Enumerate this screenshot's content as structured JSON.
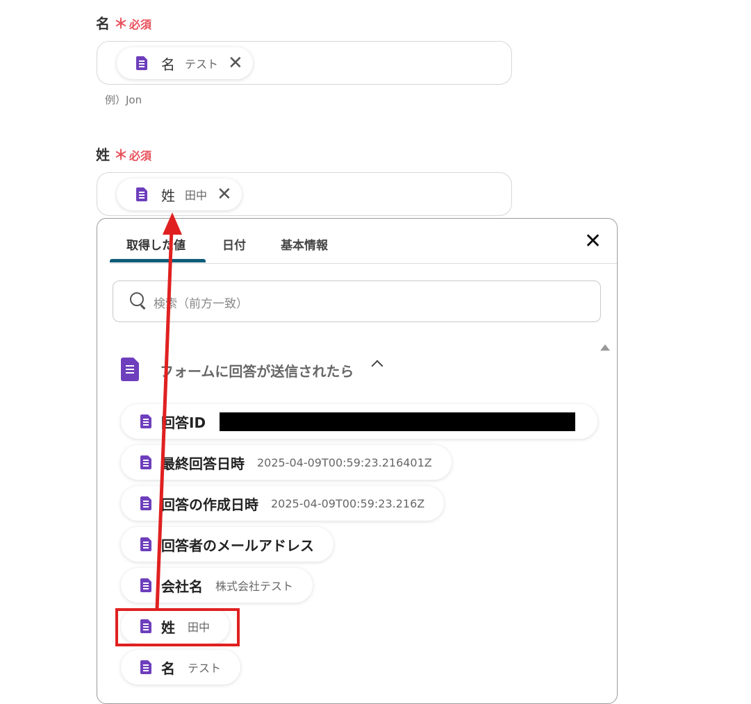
{
  "fields": [
    {
      "label": "名",
      "required_mark": "＊",
      "required_text": "必須",
      "chip_name": "名",
      "chip_value": "テスト",
      "chip_remove": "✕",
      "hint": "例）Jon"
    },
    {
      "label": "姓",
      "required_mark": "＊",
      "required_text": "必須",
      "chip_name": "姓",
      "chip_value": "田中",
      "chip_remove": "✕"
    }
  ],
  "panel": {
    "tabs": [
      "取得した値",
      "日付",
      "基本情報"
    ],
    "active_tab": 0,
    "close_label": "✕",
    "search_placeholder": "検索（前方一致）",
    "group": {
      "title": "フォームに回答が送信されたら",
      "expanded": true,
      "items": [
        {
          "name": "回答ID",
          "value": "",
          "redacted": true
        },
        {
          "name": "最終回答日時",
          "value": "2025-04-09T00:59:23.216401Z"
        },
        {
          "name": "回答の作成日時",
          "value": "2025-04-09T00:59:23.216Z"
        },
        {
          "name": "回答者のメールアドレス",
          "value": ""
        },
        {
          "name": "会社名",
          "value": "株式会社テスト"
        },
        {
          "name": "姓",
          "value": "田中",
          "highlighted": true
        },
        {
          "name": "名",
          "value": "テスト"
        }
      ]
    }
  },
  "annotation": {
    "color": "#e02020",
    "icon": "google-forms-icon"
  }
}
